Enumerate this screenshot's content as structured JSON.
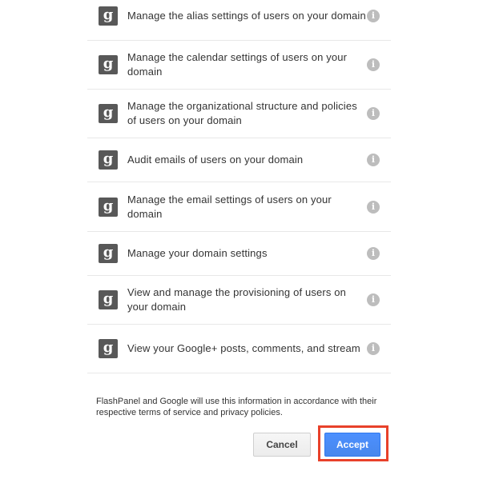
{
  "permissions": [
    {
      "icon": "g",
      "text": "Manage the alias settings of users on your domain",
      "info": "i"
    },
    {
      "icon": "g",
      "text": "Manage the calendar settings of users on your domain",
      "info": "i"
    },
    {
      "icon": "g",
      "text": "Manage the organizational structure and policies of users on your domain",
      "info": "i"
    },
    {
      "icon": "g",
      "text": "Audit emails of users on your domain",
      "info": "i"
    },
    {
      "icon": "g",
      "text": "Manage the email settings of users on your domain",
      "info": "i"
    },
    {
      "icon": "g",
      "text": "Manage your domain settings",
      "info": "i"
    },
    {
      "icon": "g",
      "text": "View and manage the provisioning of users on your domain",
      "info": "i"
    },
    {
      "icon": "g",
      "text": "View your Google+ posts, comments, and stream",
      "info": "i"
    }
  ],
  "footer": {
    "terms_text": "FlashPanel and Google will use this information in accordance with their respective terms of service and privacy policies.",
    "cancel_label": "Cancel",
    "accept_label": "Accept"
  },
  "colors": {
    "accept_blue": "#4d90fe",
    "highlight_red": "#e8412a",
    "google_icon_gray": "#585858"
  }
}
